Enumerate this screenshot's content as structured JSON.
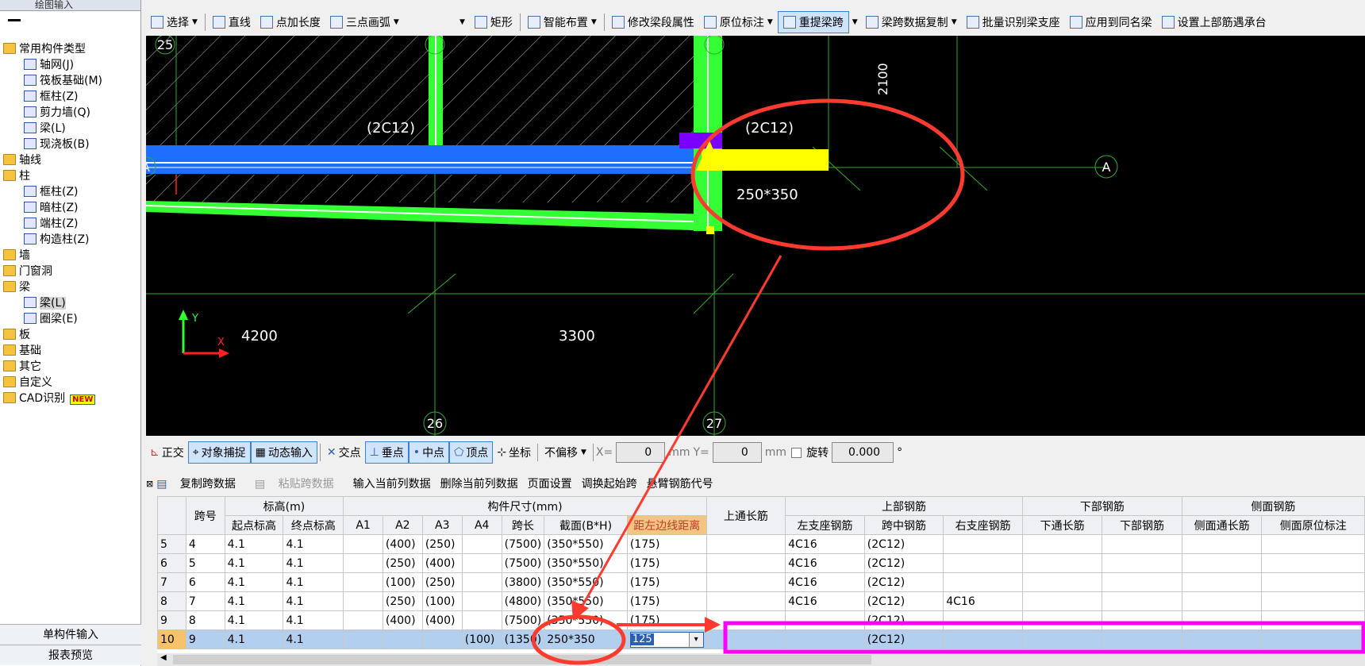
{
  "sidebar": {
    "top_label": "绘图输入",
    "items": [
      {
        "label": "常用构件类型",
        "type": "folder"
      },
      {
        "label": "轴网(J)",
        "type": "comp"
      },
      {
        "label": "筏板基础(M)",
        "type": "comp"
      },
      {
        "label": "框柱(Z)",
        "type": "comp"
      },
      {
        "label": "剪力墙(Q)",
        "type": "comp"
      },
      {
        "label": "梁(L)",
        "type": "comp"
      },
      {
        "label": "现浇板(B)",
        "type": "comp"
      },
      {
        "label": "轴线",
        "type": "folder"
      },
      {
        "label": "柱",
        "type": "folder"
      },
      {
        "label": "框柱(Z)",
        "type": "comp"
      },
      {
        "label": "暗柱(Z)",
        "type": "comp"
      },
      {
        "label": "端柱(Z)",
        "type": "comp"
      },
      {
        "label": "构造柱(Z)",
        "type": "comp"
      },
      {
        "label": "墙",
        "type": "folder"
      },
      {
        "label": "门窗洞",
        "type": "folder"
      },
      {
        "label": "梁",
        "type": "folder"
      },
      {
        "label": "梁(L)",
        "type": "comp",
        "selected": true
      },
      {
        "label": "圈梁(E)",
        "type": "comp"
      },
      {
        "label": "板",
        "type": "folder"
      },
      {
        "label": "基础",
        "type": "folder"
      },
      {
        "label": "其它",
        "type": "folder"
      },
      {
        "label": "自定义",
        "type": "folder"
      },
      {
        "label": "CAD识别",
        "type": "folder",
        "badge": "NEW"
      }
    ],
    "single_input": "单构件输入",
    "report": "报表预览"
  },
  "toolbar": {
    "select": "选择",
    "line": "直线",
    "point_len": "点加长度",
    "arc": "三点画弧",
    "rect": "矩形",
    "smart": "智能布置",
    "modify": "修改梁段属性",
    "inplace": "原位标注",
    "repick": "重提梁跨",
    "copy_span": "梁跨数据复制",
    "batch": "批量识别梁支座",
    "apply": "应用到同名梁",
    "set_top": "设置上部筋遇承台"
  },
  "canvas": {
    "axis_25": "25",
    "axis_26": "26",
    "axis_27": "27",
    "axis_a": "A",
    "label_2c12_left": "(2C12)",
    "label_2c12_right": "(2C12)",
    "label_section": "250*350",
    "dim_2100": "2100",
    "dim_4200": "4200",
    "dim_3300": "3300",
    "ucs_y": "Y",
    "ucs_x": "X"
  },
  "snapbar": {
    "ortho": "正交",
    "obj_snap": "对象捕捉",
    "dyn_input": "动态输入",
    "intersect": "交点",
    "perp": "垂点",
    "mid": "中点",
    "vertex": "顶点",
    "coord": "坐标",
    "offset": "不偏移",
    "x_label": "X=",
    "x_val": "0",
    "mm1": "mm",
    "y_label": "Y=",
    "y_val": "0",
    "mm2": "mm",
    "rotate": "旋转",
    "rot_val": "0.000",
    "deg": "°"
  },
  "gridbar": {
    "copy": "复制跨数据",
    "paste": "粘贴跨数据",
    "input_col": "输入当前列数据",
    "del_col": "删除当前列数据",
    "page": "页面设置",
    "swap": "调换起始跨",
    "cant": "悬臂钢筋代号"
  },
  "grid": {
    "headers": {
      "span_no": "跨号",
      "elev": "标高(m)",
      "start_elev": "起点标高",
      "end_elev": "终点标高",
      "size": "构件尺寸(mm)",
      "a1": "A1",
      "a2": "A2",
      "a3": "A3",
      "a4": "A4",
      "span_len": "跨长",
      "section": "截面(B*H)",
      "dist_left": "距左边线距离",
      "top_through": "上通长筋",
      "top_rebar": "上部钢筋",
      "left_sup": "左支座钢筋",
      "mid": "跨中钢筋",
      "right_sup": "右支座钢筋",
      "bottom_rebar": "下部钢筋",
      "bot_through": "下通长筋",
      "bot": "下部钢筋",
      "side_rebar": "侧面钢筋",
      "side_through": "侧面通长筋",
      "side_inplace": "侧面原位标注"
    },
    "rows": [
      {
        "rn": "5",
        "span": "4",
        "s": "4.1",
        "e": "4.1",
        "a1": "",
        "a2": "(400)",
        "a3": "(250)",
        "a4": "",
        "len": "(7500)",
        "sec": "(350*550)",
        "dist": "(175)",
        "tt": "",
        "ls": "4C16",
        "mid": "(2C12)",
        "rs": "",
        "bt": "",
        "b": "",
        "st": "",
        "si": ""
      },
      {
        "rn": "6",
        "span": "5",
        "s": "4.1",
        "e": "4.1",
        "a1": "",
        "a2": "(250)",
        "a3": "(400)",
        "a4": "",
        "len": "(7500)",
        "sec": "(350*550)",
        "dist": "(175)",
        "tt": "",
        "ls": "4C16",
        "mid": "(2C12)",
        "rs": "",
        "bt": "",
        "b": "",
        "st": "",
        "si": ""
      },
      {
        "rn": "7",
        "span": "6",
        "s": "4.1",
        "e": "4.1",
        "a1": "",
        "a2": "(100)",
        "a3": "(250)",
        "a4": "",
        "len": "(3800)",
        "sec": "(350*550)",
        "dist": "(175)",
        "tt": "",
        "ls": "4C16",
        "mid": "(2C12)",
        "rs": "",
        "bt": "",
        "b": "",
        "st": "",
        "si": ""
      },
      {
        "rn": "8",
        "span": "7",
        "s": "4.1",
        "e": "4.1",
        "a1": "",
        "a2": "(250)",
        "a3": "(100)",
        "a4": "",
        "len": "(4800)",
        "sec": "(350*550)",
        "dist": "(175)",
        "tt": "",
        "ls": "4C16",
        "mid": "(2C12)",
        "rs": "4C16",
        "bt": "",
        "b": "",
        "st": "",
        "si": ""
      },
      {
        "rn": "9",
        "span": "8",
        "s": "4.1",
        "e": "4.1",
        "a1": "",
        "a2": "(400)",
        "a3": "(400)",
        "a4": "",
        "len": "(7500)",
        "sec": "(350*550)",
        "dist": "(175)",
        "tt": "",
        "ls": "",
        "mid": "(2C12)",
        "rs": "",
        "bt": "",
        "b": "",
        "st": "",
        "si": ""
      },
      {
        "rn": "10",
        "span": "9",
        "s": "4.1",
        "e": "4.1",
        "a1": "",
        "a2": "",
        "a3": "",
        "a4": "(100)",
        "len": "(1350)",
        "sec": "250*350",
        "dist": "125",
        "tt": "",
        "ls": "",
        "mid": "(2C12)",
        "rs": "",
        "bt": "",
        "b": "",
        "st": "",
        "si": ""
      }
    ]
  },
  "colors": {
    "annotation_red": "#ff3b30",
    "highlight_magenta": "#ff00ff",
    "beam_blue": "#1f6fff",
    "column_green": "#33ff33",
    "yellow": "#ffff00",
    "purple": "#7a00ff"
  }
}
